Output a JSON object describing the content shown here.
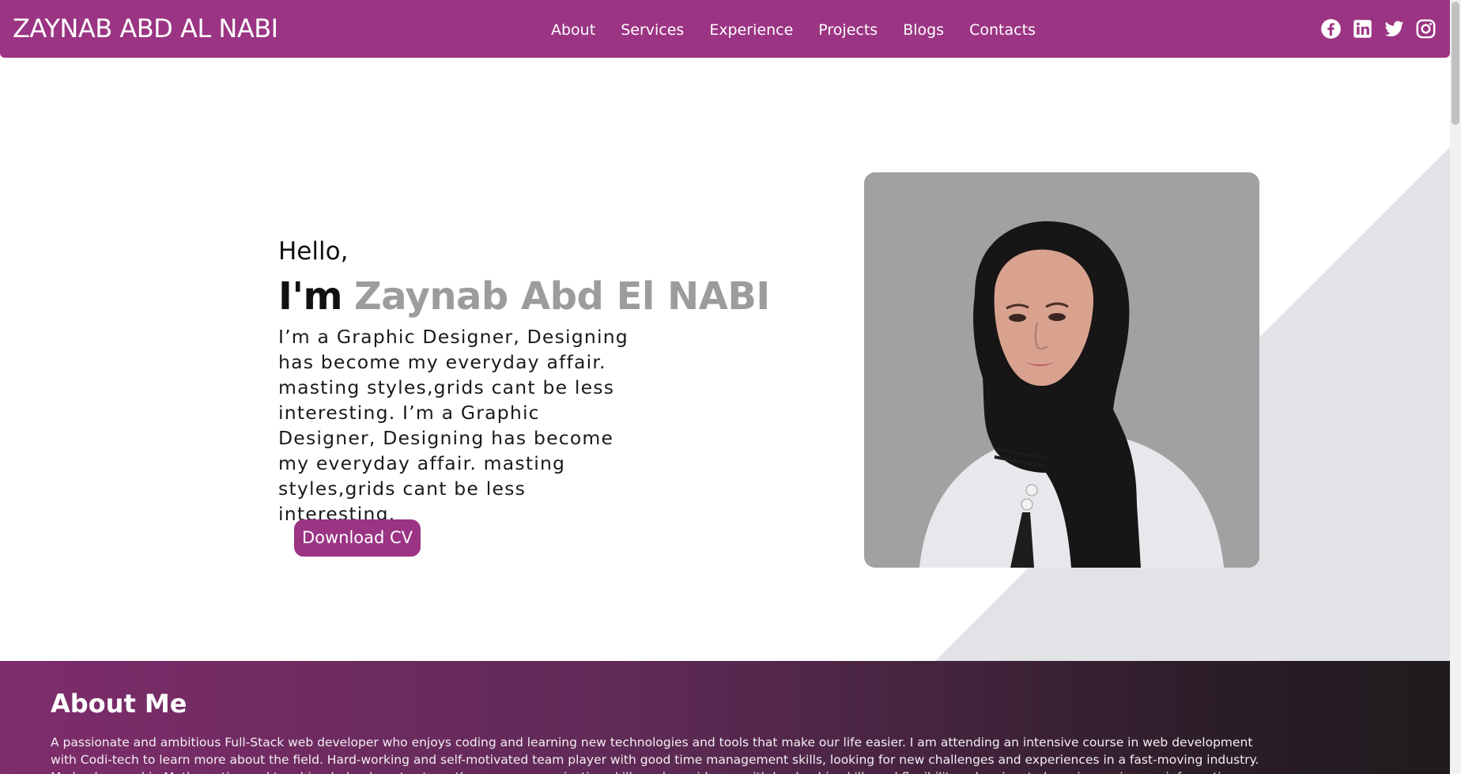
{
  "brand": {
    "name": "ZAYNAB ABD AL NABI"
  },
  "nav": {
    "items": [
      {
        "label": "About"
      },
      {
        "label": "Services"
      },
      {
        "label": "Experience"
      },
      {
        "label": "Projects"
      },
      {
        "label": "Blogs"
      },
      {
        "label": "Contacts"
      }
    ]
  },
  "socials": {
    "icons": [
      "facebook-icon",
      "linkedin-icon",
      "twitter-icon",
      "instagram-icon"
    ]
  },
  "hero": {
    "greeting": "Hello,",
    "im": "I'm",
    "name": "Zaynab Abd El NABI",
    "bio": "I’m a Graphic Designer, Designing has become my everyday affair. masting styles,grids cant be less interesting. I’m a Graphic Designer, Designing has become my everyday affair. masting styles,grids cant be less interesting.",
    "cv_button": "Download CV"
  },
  "about": {
    "title": "About Me",
    "text": "A passionate and ambitious Full-Stack web developer who enjoys coding and learning new technologies and tools that make our life easier. I am attending an intensive course in web development with Codi-tech to learn more about the field. Hard-working and self-motivated team player with good time management skills, looking for new challenges and experiences in a fast-moving industry. My background in Mathematics and teaching helped me to strengthen my communication skills and provide me with leadership skills and flexibility, who aims to keep improving my information."
  },
  "colors": {
    "brand": "#9b3483",
    "name_gray": "#9c9c9c",
    "photo_bg": "#a1a1a1",
    "diagonal": "#e2e3e7"
  }
}
